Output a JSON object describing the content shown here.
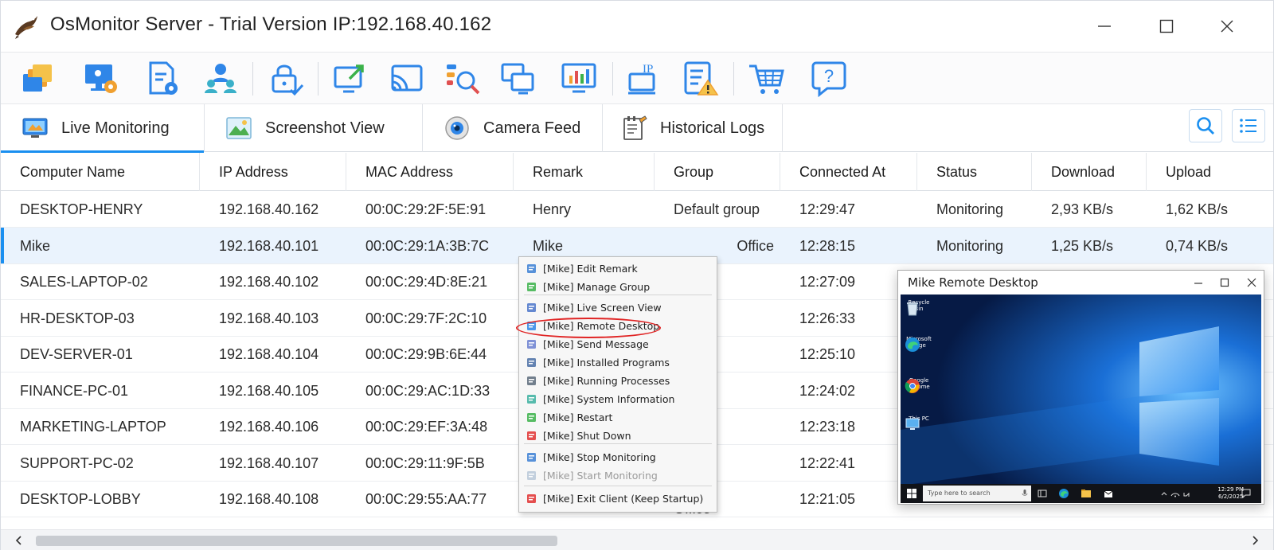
{
  "window": {
    "title": "OsMonitor Server - Trial Version IP:192.168.40.162"
  },
  "colors": {
    "accent": "#1a8ff0",
    "selected_row": "#eaf3fd",
    "highlight": "#e02424"
  },
  "toolbar": {
    "icons": [
      "client-windows-icon",
      "monitor-settings-icon",
      "document-settings-icon",
      "user-group-icon",
      "lock-check-icon",
      "screen-share-icon",
      "cast-icon",
      "search-analyze-icon",
      "remote-monitors-icon",
      "bar-chart-icon",
      "ip-computer-icon",
      "checklist-warning-icon",
      "cart-icon",
      "help-icon"
    ],
    "ip_label": "IP"
  },
  "tabs": [
    {
      "label": "Live Monitoring",
      "icon": "monitor-icon",
      "active": true
    },
    {
      "label": "Screenshot View",
      "icon": "image-icon",
      "active": false
    },
    {
      "label": "Camera Feed",
      "icon": "camera-icon",
      "active": false
    },
    {
      "label": "Historical Logs",
      "icon": "notepad-icon",
      "active": false
    }
  ],
  "table": {
    "columns": [
      "Computer Name",
      "IP Address",
      "MAC Address",
      "Remark",
      "Group",
      "Connected At",
      "Status",
      "Download",
      "Upload"
    ],
    "rows": [
      {
        "name": "DESKTOP-HENRY",
        "ip": "192.168.40.162",
        "mac": "00:0C:29:2F:5E:91",
        "remark": "Henry",
        "group": "Default group",
        "connected": "12:29:47",
        "status": "Monitoring",
        "download": "2,93 KB/s",
        "upload": "1,62 KB/s"
      },
      {
        "name": "Mike",
        "ip": "192.168.40.101",
        "mac": "00:0C:29:1A:3B:7C",
        "remark": "Mike",
        "group": "Office",
        "connected": "12:28:15",
        "status": "Monitoring",
        "download": "1,25 KB/s",
        "upload": "0,74 KB/s"
      },
      {
        "name": "SALES-LAPTOP-02",
        "ip": "192.168.40.102",
        "mac": "00:0C:29:4D:8E:21",
        "remark": "",
        "group": "",
        "connected": "12:27:09",
        "status": "",
        "download": "",
        "upload": ""
      },
      {
        "name": "HR-DESKTOP-03",
        "ip": "192.168.40.103",
        "mac": "00:0C:29:7F:2C:10",
        "remark": "",
        "group": "",
        "connected": "12:26:33",
        "status": "",
        "download": "",
        "upload": ""
      },
      {
        "name": "DEV-SERVER-01",
        "ip": "192.168.40.104",
        "mac": "00:0C:29:9B:6E:44",
        "remark": "",
        "group": "",
        "connected": "12:25:10",
        "status": "",
        "download": "",
        "upload": ""
      },
      {
        "name": "FINANCE-PC-01",
        "ip": "192.168.40.105",
        "mac": "00:0C:29:AC:1D:33",
        "remark": "",
        "group": "",
        "connected": "12:24:02",
        "status": "",
        "download": "",
        "upload": ""
      },
      {
        "name": "MARKETING-LAPTOP",
        "ip": "192.168.40.106",
        "mac": "00:0C:29:EF:3A:48",
        "remark": "",
        "group": "",
        "connected": "12:23:18",
        "status": "",
        "download": "",
        "upload": ""
      },
      {
        "name": "SUPPORT-PC-02",
        "ip": "192.168.40.107",
        "mac": "00:0C:29:11:9F:5B",
        "remark": "",
        "group": "",
        "connected": "12:22:41",
        "status": "",
        "download": "",
        "upload": ""
      },
      {
        "name": "DESKTOP-LOBBY",
        "ip": "192.168.40.108",
        "mac": "00:0C:29:55:AA:77",
        "remark": "",
        "group": "Office",
        "connected": "12:21:05",
        "status": "",
        "download": "",
        "upload": ""
      }
    ]
  },
  "context_menu": {
    "items": [
      {
        "label": "[Mike] Edit Remark",
        "icon": "pencil-icon"
      },
      {
        "label": "[Mike] Manage Group",
        "icon": "group-icon"
      },
      {
        "label": "[Mike] Live Screen View",
        "icon": "screen-view-icon"
      },
      {
        "label": "[Mike] Remote Desktop",
        "icon": "remote-desktop-icon"
      },
      {
        "label": "[Mike] Send Message",
        "icon": "message-icon"
      },
      {
        "label": "[Mike] Installed Programs",
        "icon": "programs-icon"
      },
      {
        "label": "[Mike] Running Processes",
        "icon": "processes-icon"
      },
      {
        "label": "[Mike] System Information",
        "icon": "system-info-icon"
      },
      {
        "label": "[Mike] Restart",
        "icon": "restart-icon"
      },
      {
        "label": "[Mike] Shut Down",
        "icon": "shutdown-icon"
      },
      {
        "label": "[Mike] Stop Monitoring",
        "icon": "stop-monitoring-icon"
      },
      {
        "label": "[Mike] Start Monitoring",
        "icon": "start-monitoring-icon",
        "disabled": true
      },
      {
        "label": "[Mike] Exit Client (Keep Startup)",
        "icon": "exit-icon"
      }
    ]
  },
  "remote_desktop": {
    "title": "Mike Remote Desktop",
    "desktop_icons": [
      "Recycle Bin",
      "Microsoft Edge",
      "Google Chrome",
      "This PC"
    ],
    "search_placeholder": "Type here to search",
    "clock_time": "12:29 PM",
    "clock_date": "6/2/2025"
  }
}
